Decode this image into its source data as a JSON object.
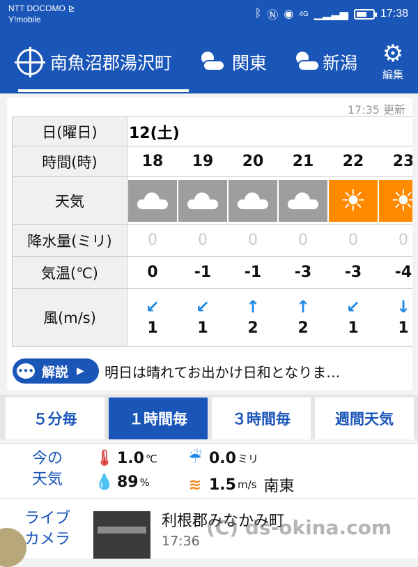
{
  "status": {
    "carrier1": "NTT DOCOMO",
    "carrier2": "Y!mobile",
    "time": "17:38",
    "network": "4G"
  },
  "header": {
    "locations": [
      {
        "label": "南魚沼郡湯沢町",
        "icon": "crosshair-icon"
      },
      {
        "label": "関東",
        "icon": "cloud-sun-icon"
      },
      {
        "label": "新潟",
        "icon": "cloud-sun-icon"
      }
    ],
    "settings_label": "編集"
  },
  "forecast": {
    "updated": "17:35 更新",
    "row_labels": {
      "day": "日(曜日)",
      "hour": "時間(時)",
      "weather": "天気",
      "rain": "降水量(ミリ)",
      "temp": "気温(℃)",
      "wind": "風(m/s)"
    },
    "day": "12(土)",
    "hours": [
      {
        "hour": "18",
        "weather": "cloud",
        "rain": "0",
        "temp": "0",
        "wind": "1",
        "wind_dir": "↙"
      },
      {
        "hour": "19",
        "weather": "cloud",
        "rain": "0",
        "temp": "-1",
        "wind": "1",
        "wind_dir": "↙"
      },
      {
        "hour": "20",
        "weather": "cloud",
        "rain": "0",
        "temp": "-1",
        "wind": "2",
        "wind_dir": "↑"
      },
      {
        "hour": "21",
        "weather": "cloud",
        "rain": "0",
        "temp": "-3",
        "wind": "2",
        "wind_dir": "↑"
      },
      {
        "hour": "22",
        "weather": "sun",
        "rain": "0",
        "temp": "-3",
        "wind": "1",
        "wind_dir": "↙"
      },
      {
        "hour": "23",
        "weather": "sun",
        "rain": "0",
        "temp": "-4",
        "wind": "1",
        "wind_dir": "↓"
      }
    ]
  },
  "commentary": {
    "button_label": "解説",
    "text": "明日は晴れてお出かけ日和となりま…"
  },
  "interval_tabs": [
    {
      "label": "５分毎",
      "active": false
    },
    {
      "label": "１時間毎",
      "active": true
    },
    {
      "label": "３時間毎",
      "active": false
    },
    {
      "label": "週間天気",
      "active": false
    }
  ],
  "current": {
    "label_line1": "今の",
    "label_line2": "天気",
    "temperature": "1.0",
    "temperature_unit": "℃",
    "humidity": "89",
    "humidity_unit": "%",
    "rain": "0.0",
    "rain_unit": "ミリ",
    "wind": "1.5",
    "wind_unit": "m/s",
    "wind_direction": "南東"
  },
  "live": {
    "label_line1": "ライブ",
    "label_line2": "カメラ",
    "title": "利根郡みなかみ町",
    "time": "17:36"
  },
  "watermark": "(C) ds-okina.com",
  "colors": {
    "primary": "#1a55b8",
    "sun": "#ff8a00",
    "cloud": "#9e9e9e"
  }
}
